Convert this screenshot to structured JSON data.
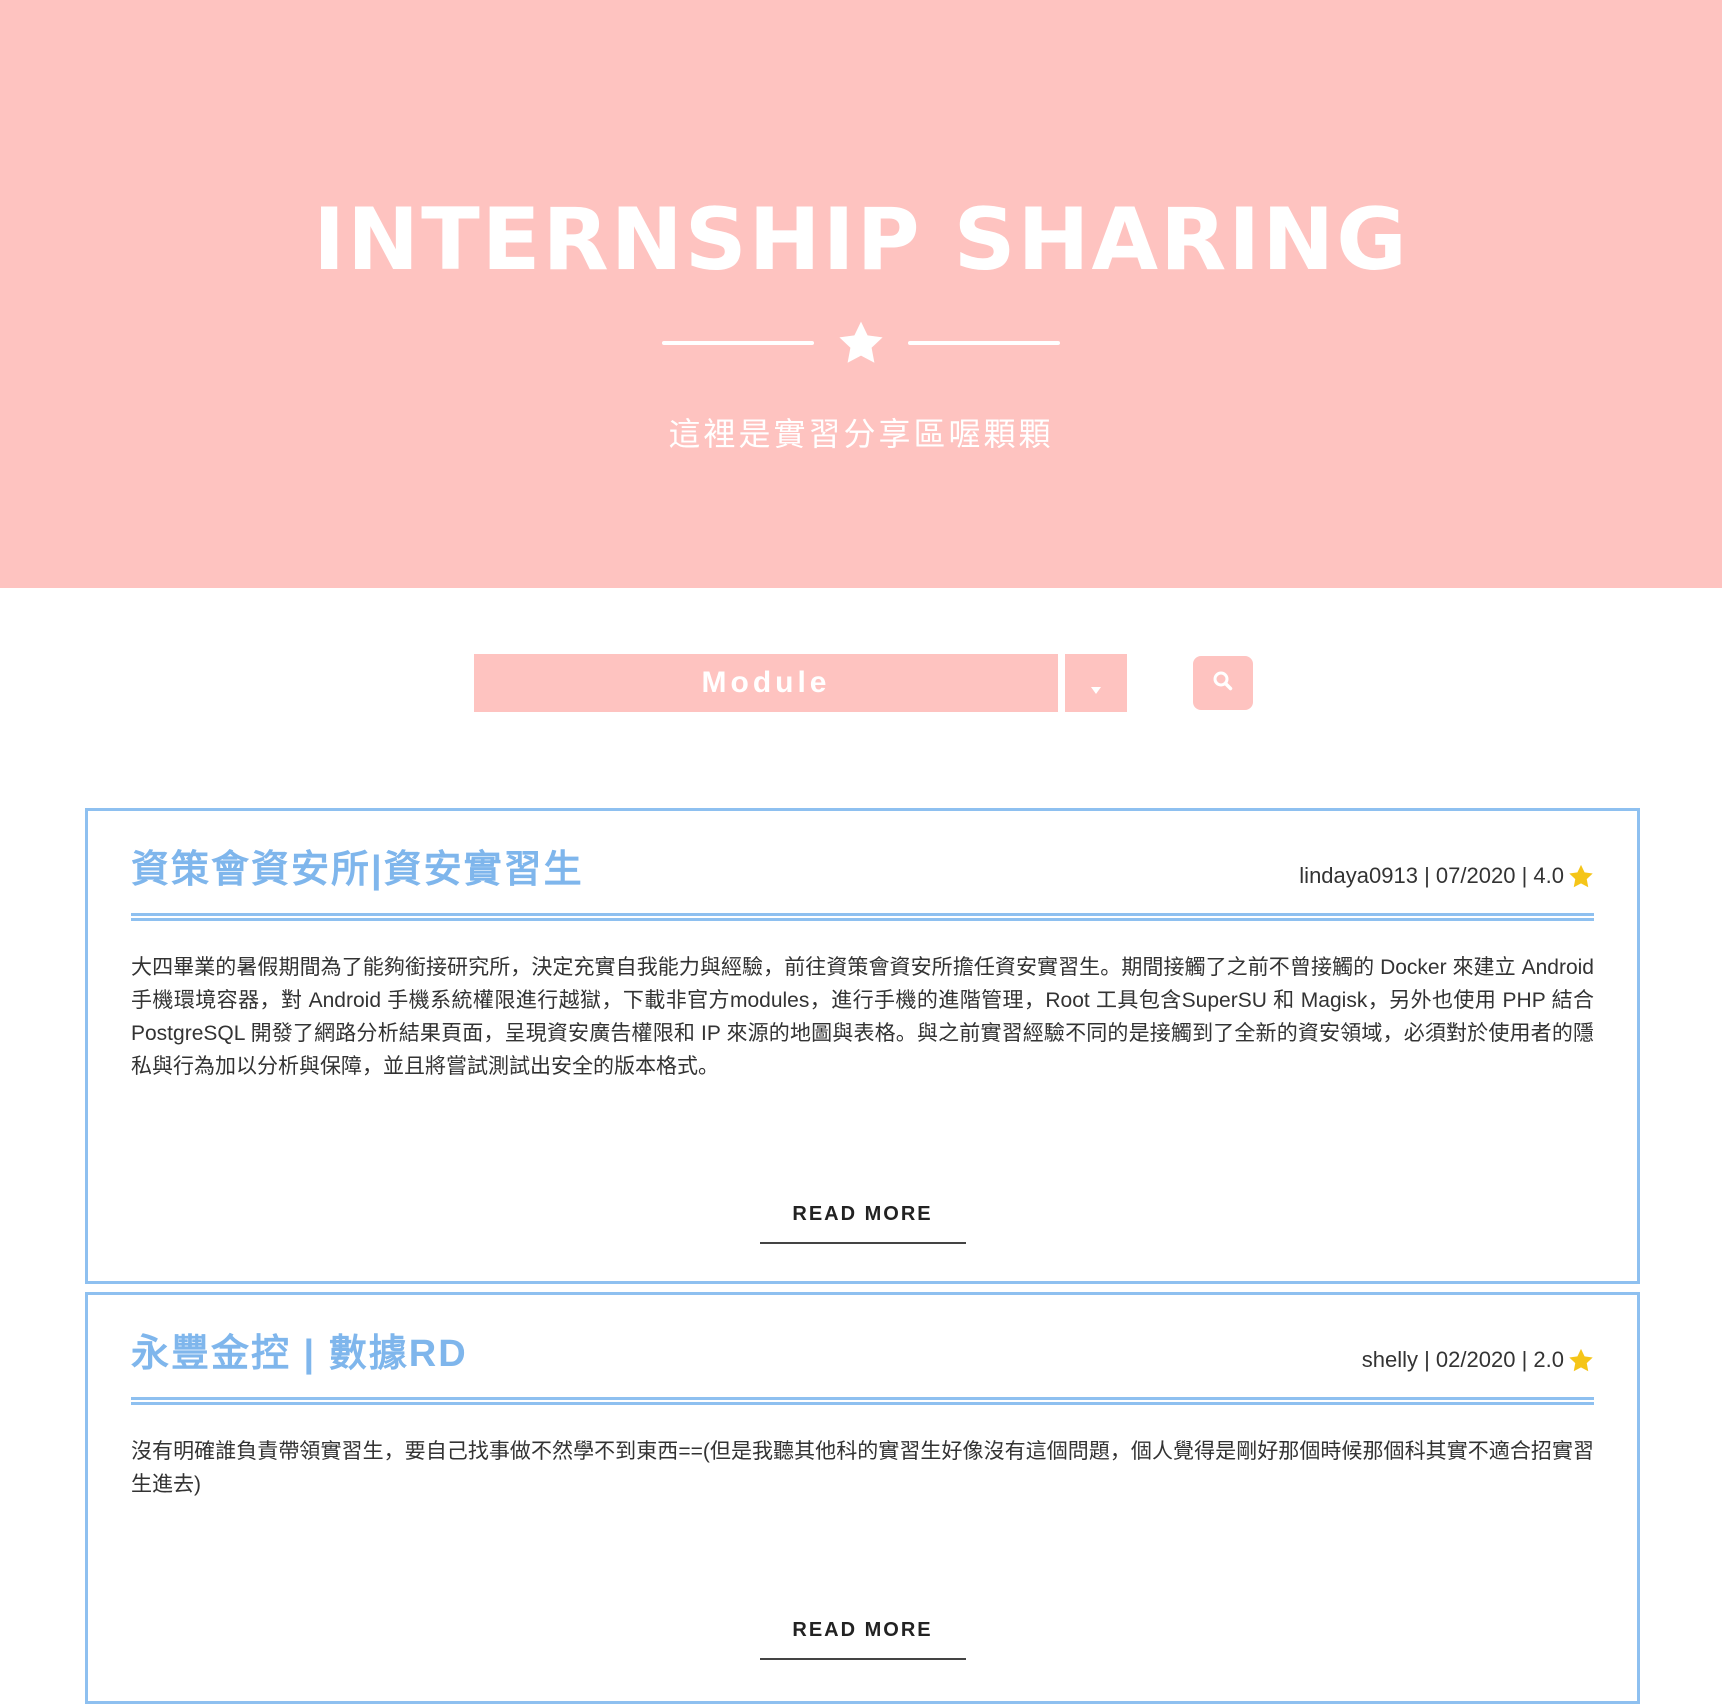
{
  "hero": {
    "title": "INTERNSHIP SHARING",
    "subtitle": "這裡是實習分享區喔顆顆",
    "divider_icon": "star-icon"
  },
  "filter": {
    "module_label": "Module",
    "dropdown_icon": "chevron-down-icon",
    "search_icon": "search-icon"
  },
  "colors": {
    "hero_bg": "#fec3c0",
    "card_border": "#8ec0f0",
    "title_blue": "#7fb6ec",
    "star_yellow": "#f5c518"
  },
  "posts": [
    {
      "title": "資策會資安所|資安實習生",
      "author": "lindaya0913",
      "date": "07/2020",
      "rating": "4.0",
      "meta_separator": " | ",
      "body": "大四畢業的暑假期間為了能夠銜接研究所，決定充實自我能力與經驗，前往資策會資安所擔任資安實習生。期間接觸了之前不曾接觸的 Docker 來建立 Android 手機環境容器，對 Android 手機系統權限進行越獄，下載非官方modules，進行手機的進階管理，Root 工具包含SuperSU 和 Magisk，另外也使用 PHP 結合 PostgreSQL 開發了網路分析結果頁面，呈現資安廣告權限和 IP 來源的地圖與表格。與之前實習經驗不同的是接觸到了全新的資安領域，必須對於使用者的隱私與行為加以分析與保障，並且將嘗試測試出安全的版本格式。",
      "read_more": "READ MORE"
    },
    {
      "title": "永豐金控 | 數據RD",
      "author": "shelly",
      "date": "02/2020",
      "rating": "2.0",
      "meta_separator": " | ",
      "body": "沒有明確誰負責帶領實習生，要自己找事做不然學不到東西==(但是我聽其他科的實習生好像沒有這個問題，個人覺得是剛好那個時候那個科其實不適合招實習生進去)",
      "read_more": "READ MORE"
    }
  ]
}
